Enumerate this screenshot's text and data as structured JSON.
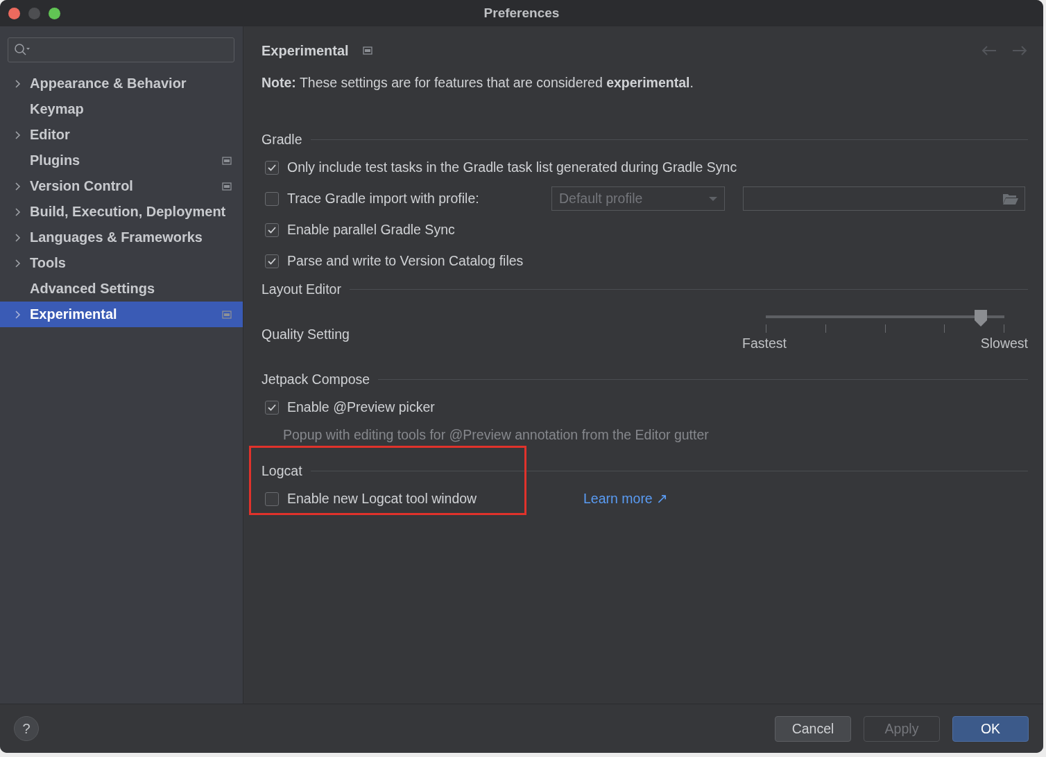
{
  "window": {
    "title": "Preferences"
  },
  "sidebar": {
    "items": [
      {
        "label": "Appearance & Behavior",
        "expandable": true,
        "badge": false,
        "selected": false
      },
      {
        "label": "Keymap",
        "expandable": false,
        "badge": false,
        "selected": false
      },
      {
        "label": "Editor",
        "expandable": true,
        "badge": false,
        "selected": false
      },
      {
        "label": "Plugins",
        "expandable": false,
        "badge": true,
        "selected": false
      },
      {
        "label": "Version Control",
        "expandable": true,
        "badge": true,
        "selected": false
      },
      {
        "label": "Build, Execution, Deployment",
        "expandable": true,
        "badge": false,
        "selected": false
      },
      {
        "label": "Languages & Frameworks",
        "expandable": true,
        "badge": false,
        "selected": false
      },
      {
        "label": "Tools",
        "expandable": true,
        "badge": false,
        "selected": false
      },
      {
        "label": "Advanced Settings",
        "expandable": false,
        "badge": false,
        "selected": false
      },
      {
        "label": "Experimental",
        "expandable": true,
        "badge": true,
        "selected": true
      }
    ]
  },
  "page": {
    "title": "Experimental",
    "badge": true,
    "note": "**Note:** These settings are for features that are considered **experimental**."
  },
  "sections": [
    {
      "title": "Gradle",
      "highlighted": false,
      "items": [
        {
          "kind": "checkbox",
          "label": "Only include test tasks in the Gradle task list generated during Gradle Sync",
          "checked": true
        },
        {
          "kind": "profile",
          "label": "Trace Gradle import with profile:",
          "checked": false,
          "dropdown": {
            "value": "Default profile",
            "disabled": true
          }
        },
        {
          "kind": "checkbox",
          "label": "Enable parallel Gradle Sync",
          "checked": true
        },
        {
          "kind": "checkbox",
          "label": "Parse and write to Version Catalog files",
          "checked": true
        }
      ]
    },
    {
      "title": "Layout Editor",
      "highlighted": false,
      "items": [
        {
          "kind": "slider",
          "label": "Quality Setting",
          "level": 0.9,
          "min_label": "Fastest",
          "max_label": "Slowest"
        }
      ]
    },
    {
      "title": "Jetpack Compose",
      "highlighted": false,
      "items": [
        {
          "kind": "checkbox",
          "label": "Enable @Preview picker",
          "checked": true
        },
        {
          "kind": "hint",
          "text": "Popup with editing tools for @Preview annotation from the Editor gutter"
        }
      ]
    },
    {
      "title": "Logcat",
      "highlighted": true,
      "items": [
        {
          "kind": "checkbox",
          "label": "Enable new Logcat tool window",
          "checked": false,
          "link": "Learn more ↗"
        }
      ]
    }
  ],
  "help": {
    "label": "?"
  },
  "buttons": [
    {
      "label": "Cancel",
      "kind": "normal"
    },
    {
      "label": "Apply",
      "kind": "disabled"
    },
    {
      "label": "OK",
      "kind": "default"
    }
  ]
}
